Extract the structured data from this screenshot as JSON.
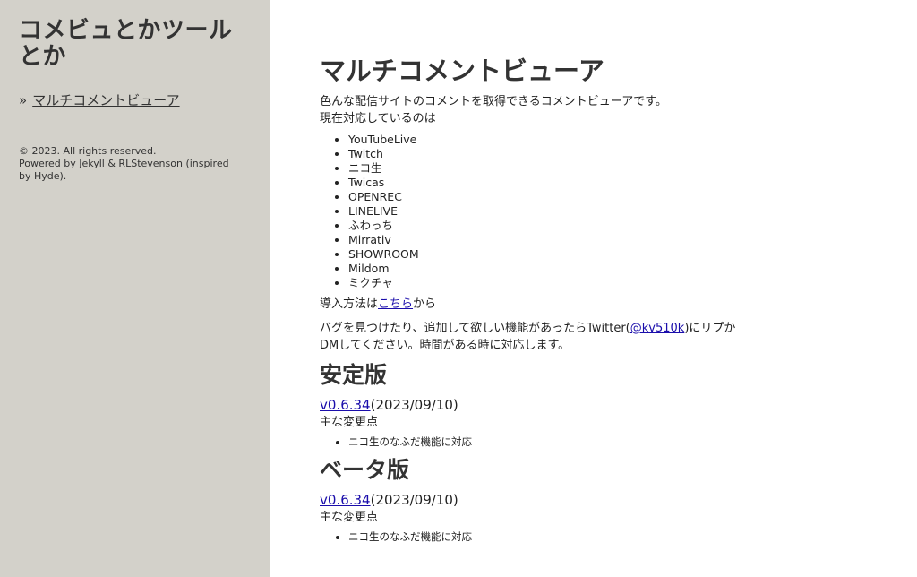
{
  "sidebar": {
    "title": "コメビュとかツールとか",
    "nav_arrow": "»",
    "nav_link": "マルチコメントビューア",
    "footer_copyright": "© 2023. All rights reserved.",
    "footer_powered": "Powered by Jekyll & RLStevenson (inspired by Hyde)."
  },
  "main": {
    "title": "マルチコメントビューア",
    "intro_line1": "色んな配信サイトのコメントを取得できるコメントビューアです。",
    "intro_line2": "現在対応しているのは",
    "sites": [
      "YouTubeLive",
      "Twitch",
      "ニコ生",
      "Twicas",
      "OPENREC",
      "LINELIVE",
      "ふわっち",
      "Mirrativ",
      "SHOWROOM",
      "Mildom",
      "ミクチャ"
    ],
    "install_prefix": "導入方法は",
    "install_link": "こちら",
    "install_suffix": "から",
    "bug_prefix": "バグを見つけたり、追加して欲しい機能があったらTwitter(",
    "twitter_handle": "@kv510k",
    "bug_suffix": ")にリプかDMしてください。時間がある時に対応します。",
    "stable": {
      "heading": "安定版",
      "version": "v0.6.34",
      "date": "(2023/09/10)",
      "changes_label": "主な変更点",
      "changes": [
        "ニコ生のなふだ機能に対応"
      ]
    },
    "beta": {
      "heading": "ベータ版",
      "version": "v0.6.34",
      "date": "(2023/09/10)",
      "changes_label": "主な変更点",
      "changes": [
        "ニコ生のなふだ機能に対応"
      ]
    }
  }
}
